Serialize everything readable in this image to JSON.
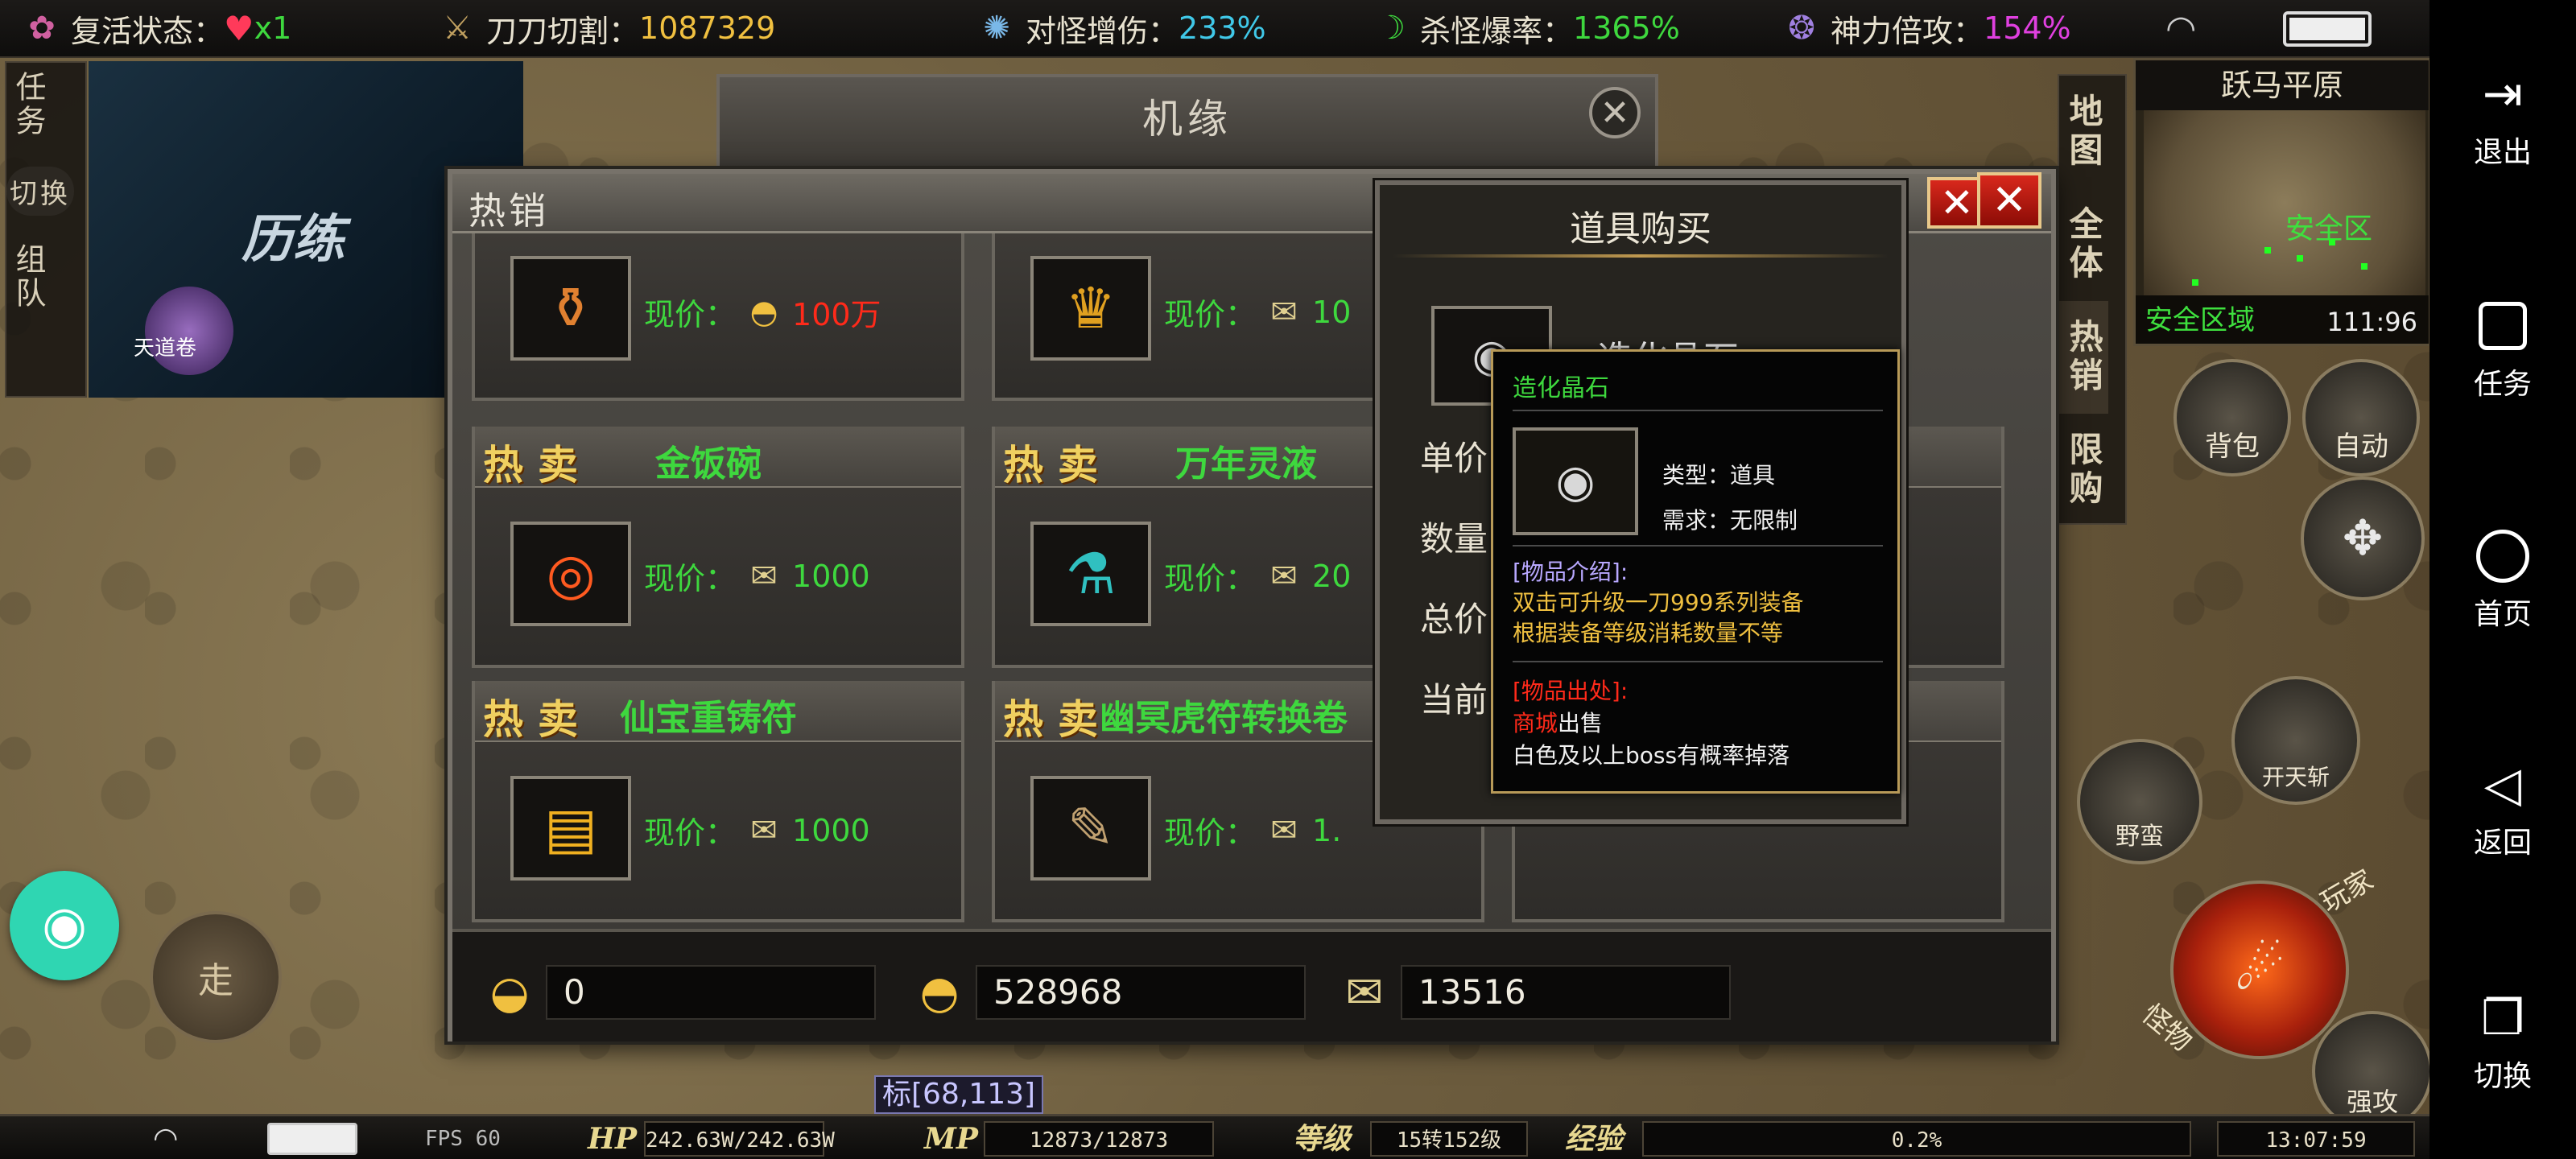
{
  "topbar": {
    "revive": {
      "label": "复活状态：",
      "value": "x1",
      "icon": "lotus-icon"
    },
    "cut": {
      "label": "刀刀切割：",
      "value": "1087329"
    },
    "dmg": {
      "label": "对怪增伤：",
      "value": "233%"
    },
    "drop": {
      "label": "杀怪爆率：",
      "value": "1365%"
    },
    "god": {
      "label": "神力倍攻：",
      "value": "154%"
    }
  },
  "left_menu": {
    "task": "任务",
    "switch": "切换",
    "team": "组队"
  },
  "banner": {
    "title": "历练",
    "small": "天道卷"
  },
  "minimap": {
    "name": "跃马平原",
    "safe": "安全区",
    "zone": "安全区域",
    "coord": "111:96"
  },
  "side_tabs": {
    "map": "地图",
    "all": "全体",
    "hot": "热销",
    "limited": "限购"
  },
  "hud_buttons": {
    "bag": "背包",
    "auto": "自动",
    "kaitian": "开天斩",
    "yeman": "野蛮",
    "qiang": "强攻",
    "walk": "走",
    "wan": "玩家",
    "guai": "怪物"
  },
  "bottombar": {
    "fps": "FPS 60",
    "hp_label": "HP",
    "hp": "242.63W/242.63W",
    "mp_label": "MP",
    "mp": "12873/12873",
    "level_label": "等级",
    "level": "15转152级",
    "exp_label": "经验",
    "exp": "0.2%",
    "time": "13:07:59"
  },
  "coord_tag": "标[68,113]",
  "jiyuan": {
    "title": "机缘"
  },
  "shop": {
    "title": "热销",
    "close": "✕",
    "hot_label": "热卖",
    "price_label": "现价：",
    "items": [
      {
        "name": "",
        "price": "100万",
        "price_red": true
      },
      {
        "name": "",
        "price": "10"
      },
      {
        "name": "金饭碗",
        "price": "1000"
      },
      {
        "name": "万年灵液",
        "price": "20"
      },
      {
        "name": "仙宝重铸符",
        "price": "1000"
      },
      {
        "name": "幽冥虎符转换卷",
        "price": "1."
      }
    ],
    "currencies": [
      {
        "icon": "gold-ingot-icon",
        "value": "0"
      },
      {
        "icon": "gold-coins-icon",
        "value": "528968"
      },
      {
        "icon": "gold-ticket-icon",
        "value": "13516"
      }
    ]
  },
  "buy_dialog": {
    "title": "道具购买",
    "item_name": "造化晶石",
    "unit_price_label": "单价",
    "quantity_label": "数量:",
    "total_label": "总价",
    "current_label": "当前"
  },
  "tooltip": {
    "title": "造化晶石",
    "type": "类型：道具",
    "requirement": "需求：无限制",
    "intro_header": "[物品介绍]:",
    "intro_1": "双击可升级一刀999系列装备",
    "intro_2": "根据装备等级消耗数量不等",
    "source_header": "[物品出处]:",
    "source_1_red": "商城",
    "source_1_rest": "出售",
    "source_2": "白色及以上boss有概率掉落"
  },
  "navbar": {
    "exit": "退出",
    "task": "任务",
    "home": "首页",
    "back": "返回",
    "switch": "切换"
  },
  "colors": {
    "green": "#3ed83e",
    "red": "#ff2a1a",
    "gold": "#f0c040",
    "purple": "#d040d0",
    "cyan": "#40c8e8"
  }
}
